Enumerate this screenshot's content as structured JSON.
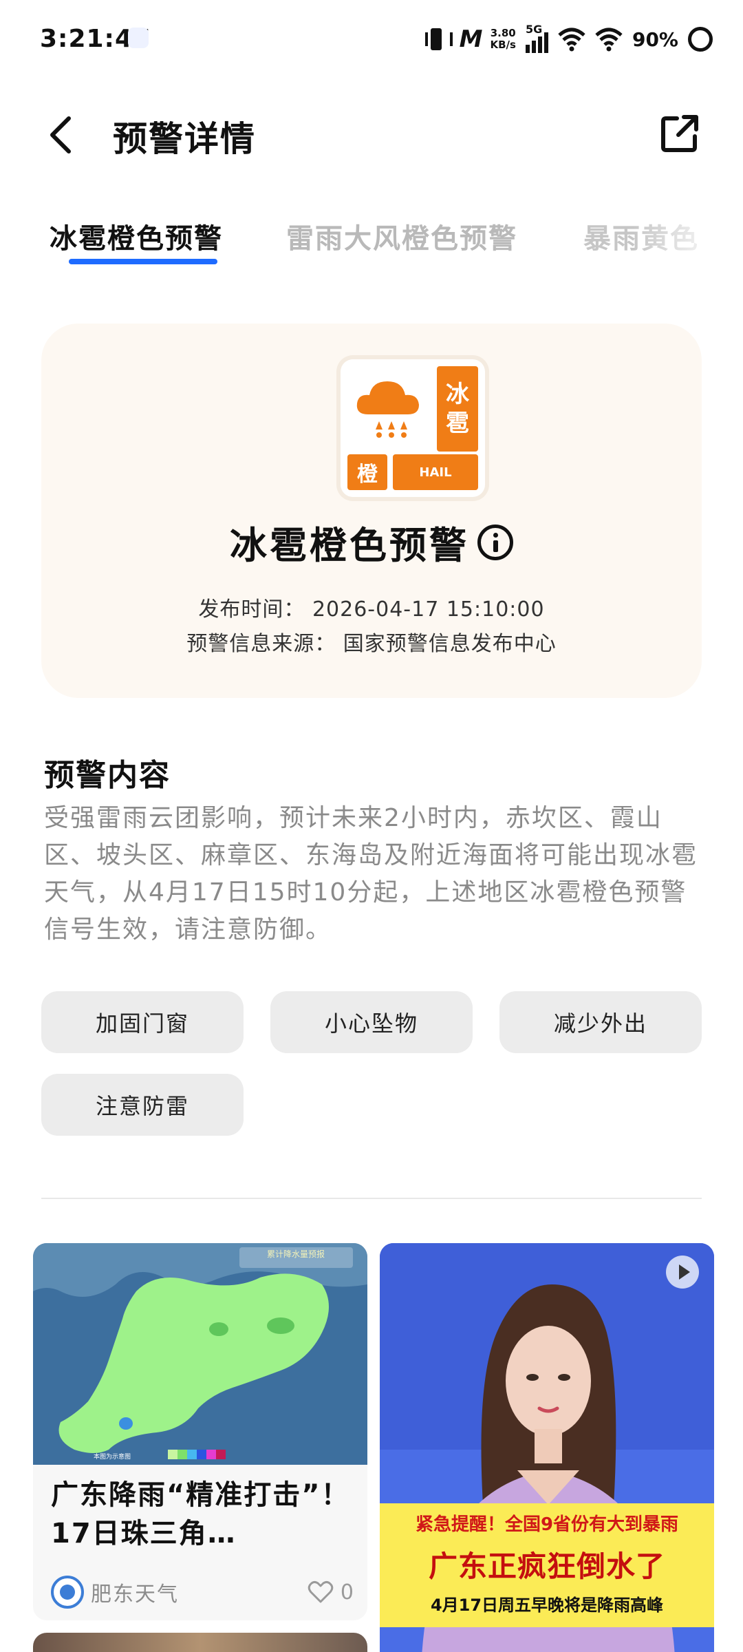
{
  "status_bar": {
    "time": "3:21:47",
    "speed_value": "3.80",
    "speed_unit": "KB/s",
    "network": "5G",
    "battery": "90%"
  },
  "header": {
    "title": "预警详情",
    "back_icon": "chevron-left-icon",
    "share_icon": "share-external-icon"
  },
  "tabs": [
    {
      "label": "冰雹橙色预警",
      "active": true
    },
    {
      "label": "雷雨大风橙色预警",
      "active": false
    },
    {
      "label": "暴雨黄色",
      "active": false
    }
  ],
  "alert": {
    "badge": {
      "side_text_1": "冰",
      "side_text_2": "雹",
      "level_char": "橙",
      "type_en": "HAIL",
      "color": "#f07d16"
    },
    "title": "冰雹橙色预警",
    "publish_time": "发布时间：  2026-04-17 15:10:00",
    "source": "预警信息来源：  国家预警信息发布中心"
  },
  "content": {
    "section_title": "预警内容",
    "text": "受强雷雨云团影响，预计未来2小时内，赤坎区、霞山区、坡头区、麻章区、东海岛及附近海面将可能出现冰雹天气，从4月17日15时10分起，上述地区冰雹橙色预警信号生效，请注意防御。"
  },
  "advice_chips": [
    "加固门窗",
    "小心坠物",
    "减少外出",
    "注意防雷"
  ],
  "feed": [
    {
      "thumb_text": "累计降水量预报",
      "thumb_note": "本图为示意图",
      "title": "广东降雨“精准打击”！17日珠三角…",
      "source": "肥东天气",
      "likes": "0"
    },
    {
      "banner_line1": "紧急提醒！全国9省份有大到暴雨",
      "banner_line2": "广东正疯狂倒水了",
      "banner_line3": "4月17日周五早晚将是降雨高峰"
    }
  ]
}
